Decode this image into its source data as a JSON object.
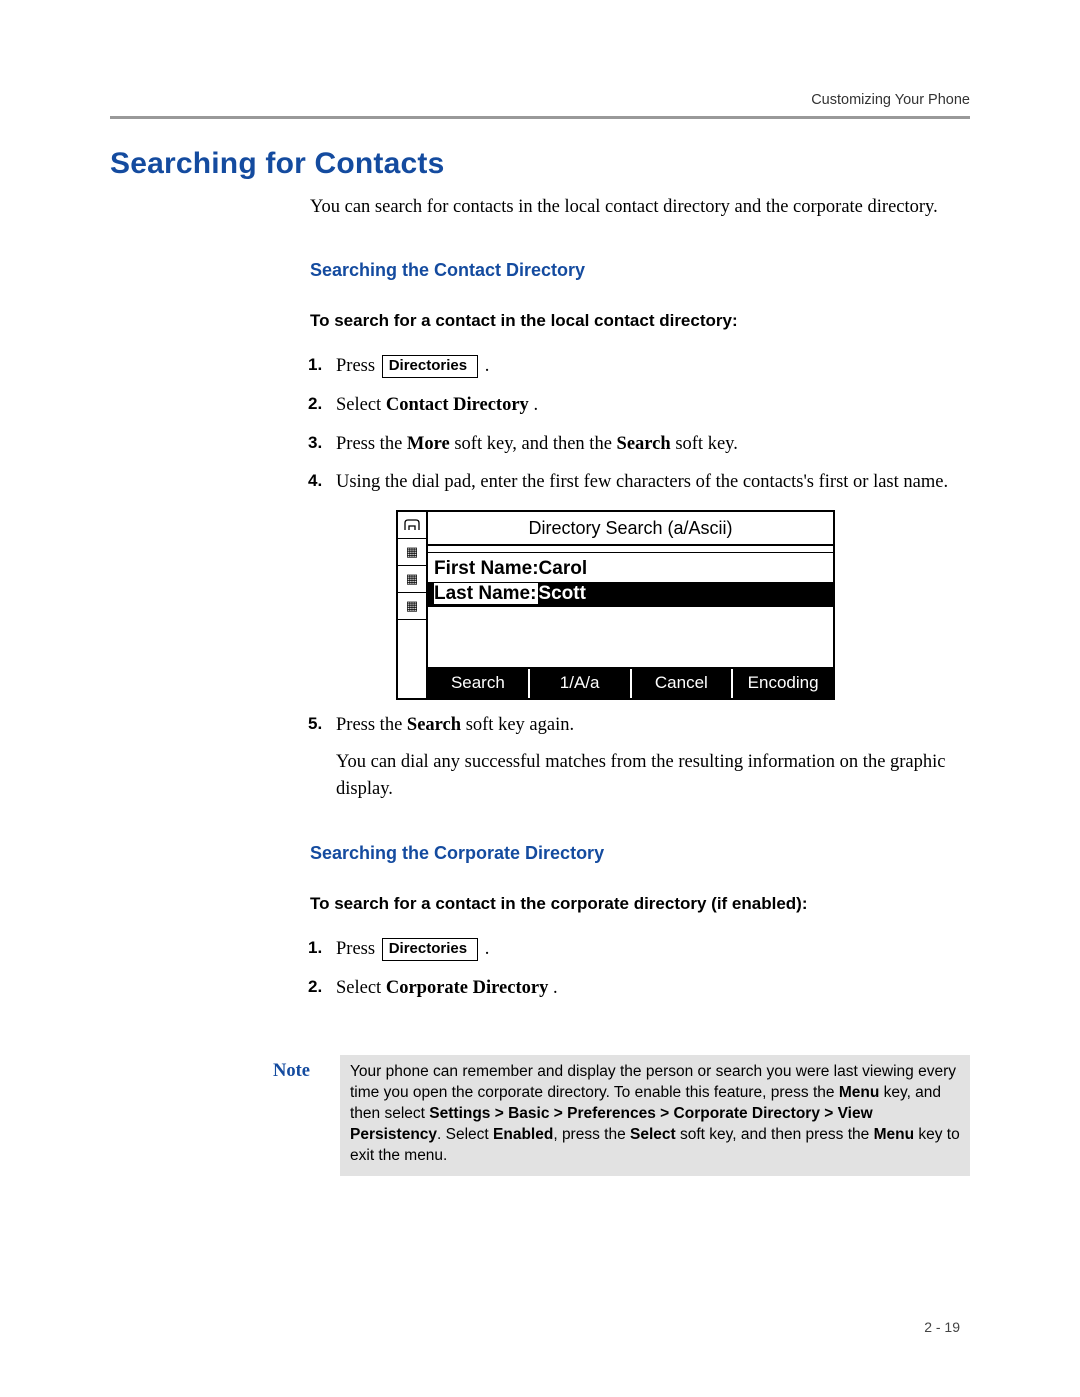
{
  "header": {
    "running": "Customizing Your Phone"
  },
  "title": "Searching for Contacts",
  "intro": "You can search for contacts in the local contact directory and the corporate directory.",
  "subhead1": "Searching the Contact Directory",
  "task1": "To search for a contact in the local contact directory:",
  "steps1": {
    "s1_num": "1.",
    "s1_a": "Press  ",
    "s1_key": "Directories",
    "s1_b": " .",
    "s2_num": "2.",
    "s2_a": "Select ",
    "s2_bold": "Contact Directory",
    "s2_b": ".",
    "s3_num": "3.",
    "s3_a": "Press the ",
    "s3_bold1": "More",
    "s3_mid": " soft key, and then the ",
    "s3_bold2": "Search",
    "s3_end": " soft key.",
    "s4_num": "4.",
    "s4": "Using the dial pad, enter the first few characters of the contacts's first or last name.",
    "s5_num": "5.",
    "s5_a": "Press the ",
    "s5_bold": "Search",
    "s5_b": " soft key again.",
    "s5_follow": "You can dial any successful matches from the resulting information on the graphic display."
  },
  "lcd": {
    "title": "Directory Search (a/Ascii)",
    "first_label": "First Name:",
    "first_value": "Carol",
    "last_label": "Last Name:",
    "last_value": "Scott",
    "softkeys": [
      "Search",
      "1/A/a",
      "Cancel",
      "Encoding"
    ]
  },
  "subhead2": "Searching the Corporate Directory",
  "task2": "To search for a contact in the corporate directory (if enabled):",
  "steps2": {
    "s1_num": "1.",
    "s1_a": "Press  ",
    "s1_key": "Directories",
    "s1_b": " .",
    "s2_num": "2.",
    "s2_a": "Select ",
    "s2_bold": "Corporate Directory",
    "s2_b": "."
  },
  "note": {
    "label": "Note",
    "t1": "Your phone can remember and display the person or search you were last viewing every time you open the corporate directory. To enable this feature, press the ",
    "b1": "Menu",
    "t2": " key, and then select ",
    "b2": "Settings > Basic > Preferences > Corporate Directory > View Persistency",
    "t3": ". Select ",
    "b3": "Enabled",
    "t4": ", press the ",
    "b4": "Select",
    "t5": " soft key, and then press the ",
    "b5": "Menu",
    "t6": " key to exit the menu."
  },
  "page_number": "2 - 19"
}
